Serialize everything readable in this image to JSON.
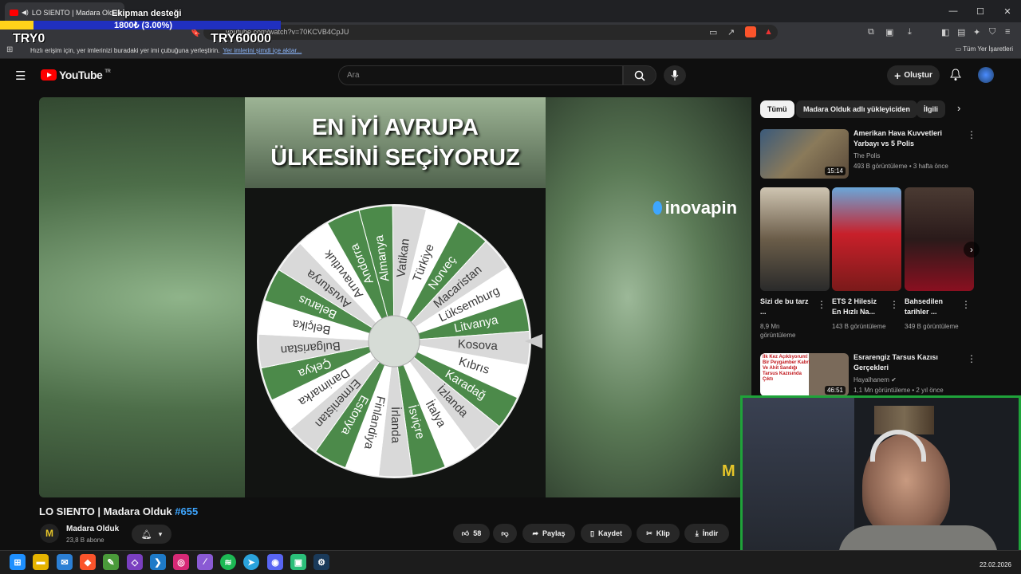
{
  "browser": {
    "tab_title": "LO SIENTO | Madara Olduk",
    "address": "youtube.com/watch?v=70KCVB4CpJU",
    "bookmarks_prompt": "Hızlı erişim için, yer imlerinizi buradaki yer imi çubuğuna yerleştirin.",
    "bookmarks_link": "Yer imlerini şimdi içe aktar...",
    "all_bookmarks": "Tüm Yer İşaretleri",
    "window_controls": [
      "minimize-icon",
      "maximize-icon",
      "close-icon"
    ]
  },
  "overlay": {
    "title": "Ekipman desteği",
    "progress_text": "1800₺ (3.00%)",
    "progress_fraction": 0.03,
    "left_amount": "TRY0",
    "right_amount": "TRY60000",
    "bar_color": "#2030c0",
    "fill_color": "#ffd21a"
  },
  "header": {
    "logo": "YouTube",
    "region": "TR",
    "search_placeholder": "Ara",
    "create_label": "Oluştur"
  },
  "video": {
    "overlay_title_line1": "EN İYİ AVRUPA",
    "overlay_title_line2": "ÜLKESİNİ SEÇİYORUZ",
    "sponsor": "inovapin",
    "corner_logo": "M",
    "wheel_items": [
      "Almanya",
      "Vatikan",
      "Türkiye",
      "Norveç",
      "Macaristan",
      "Lüksemburg",
      "Litvanya",
      "Kosova",
      "Kıbrıs",
      "Karadağ",
      "İzlanda",
      "İtalya",
      "İsviçre",
      "İrlanda",
      "Finlandiya",
      "Estonya",
      "Ermenistan",
      "Danimarka",
      "Çekya",
      "Bulgaristan",
      "Belçika",
      "Belarus",
      "Avusturya",
      "Arnavutluk",
      "Andorra"
    ],
    "wheel_colors": [
      "#4c8a4a",
      "#d9d9d9",
      "#ffffff"
    ]
  },
  "meta": {
    "title": "LO SIENTO | Madara Olduk ",
    "hashtag": "#655",
    "channel_initials": "M",
    "channel": "Madara Olduk",
    "subscribers": "23,8 B abone",
    "likes": "58",
    "share": "Paylaş",
    "save": "Kaydet",
    "clip": "Klip",
    "download": "İndir"
  },
  "chips": [
    "Tümü",
    "Madara Olduk adlı yükleyiciden",
    "İlgili"
  ],
  "related_top": {
    "title": "Amerikan Hava Kuvvetleri Yarbayı vs 5 Polis",
    "channel": "The Polis",
    "meta": "493 B görüntüleme • 3 hafta önce",
    "duration": "15:14"
  },
  "shorts": [
    {
      "title": "Sizi de bu tarz ...",
      "views": "8,9 Mn görüntüleme"
    },
    {
      "title": "ETS 2 Hilesiz En Hızlı Na...",
      "views": "143 B görüntüleme"
    },
    {
      "title": "Bahsedilen tarihler ...",
      "views": "349 B görüntüleme"
    }
  ],
  "related_second": {
    "title": "Esrarengiz Tarsus Kazısı Gerçekleri",
    "channel": "Hayalhanem",
    "meta": "1,1 Mn görüntüleme • 2 yıl önce",
    "duration": "46:51",
    "thumb_text": "İlk Kez Açıklıyorum! Bir Peygamber Kabri Ve Ahit Sandığı Tarsus Kazısında Çıktı"
  },
  "taskbar": {
    "date": "22.02.2026",
    "icons": [
      "windows-icon",
      "file-explorer-icon",
      "mail-icon",
      "brave-icon",
      "app-icon",
      "visual-studio-icon",
      "vscode-icon",
      "instagram-icon",
      "feather-icon",
      "spotify-icon",
      "telegram-icon",
      "discord-icon",
      "android-icon",
      "steam-icon"
    ]
  }
}
